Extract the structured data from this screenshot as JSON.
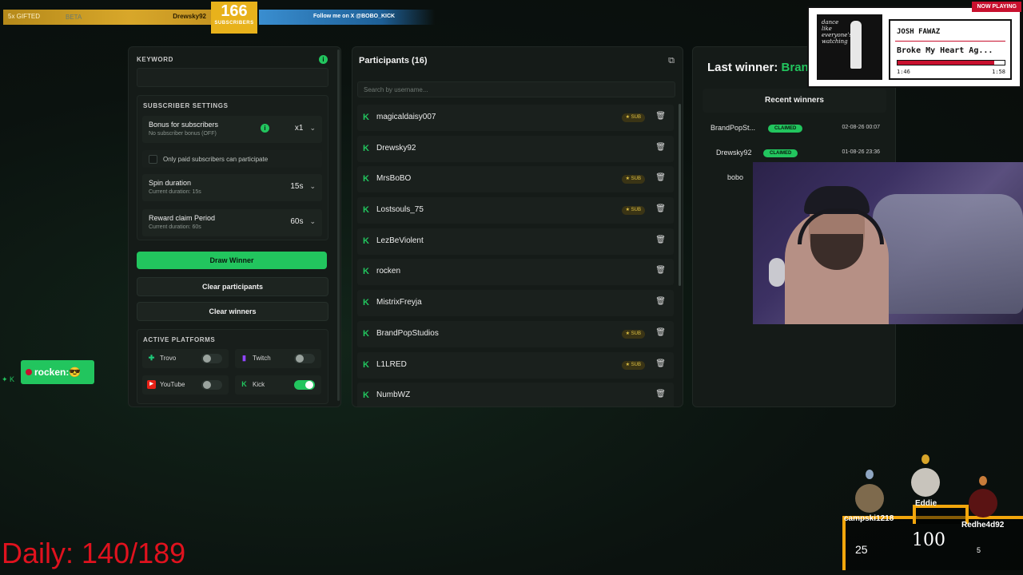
{
  "overlay": {
    "gift_text": "5x GIFTED",
    "gift_user": "Drewsky92",
    "beta_label": "BETA",
    "subscribers_count": "166",
    "subscribers_label": "SUBSCRIBERS",
    "follow_text": "Follow me on X @BOBO_KICK"
  },
  "settings": {
    "keyword_label": "KEYWORD",
    "keyword_value": "",
    "subscriber_settings_label": "SUBSCRIBER SETTINGS",
    "bonus_title": "Bonus for subscribers",
    "bonus_sub": "No subscriber bonus (OFF)",
    "bonus_value": "x1",
    "paid_only_label": "Only paid subscribers can participate",
    "spin_title": "Spin duration",
    "spin_sub": "Current duration: 15s",
    "spin_value": "15s",
    "reward_title": "Reward claim Period",
    "reward_sub": "Current duration: 60s",
    "reward_value": "60s",
    "draw_label": "Draw Winner",
    "clear_participants_label": "Clear participants",
    "clear_winners_label": "Clear winners",
    "active_platforms_label": "ACTIVE PLATFORMS",
    "platforms": [
      {
        "name": "Trovo",
        "enabled": false,
        "color": "#1ec97a"
      },
      {
        "name": "Twitch",
        "enabled": false,
        "color": "#9146ff"
      },
      {
        "name": "YouTube",
        "enabled": false,
        "color": "#e62117"
      },
      {
        "name": "Kick",
        "enabled": true,
        "color": "#22c55e"
      }
    ]
  },
  "participants": {
    "title": "Participants (16)",
    "search_placeholder": "Search by username...",
    "sub_badge": "SUB",
    "items": [
      {
        "name": "magicaldaisy007",
        "sub": true
      },
      {
        "name": "Drewsky92",
        "sub": false
      },
      {
        "name": "MrsBoBO",
        "sub": true
      },
      {
        "name": "Lostsouls_75",
        "sub": true
      },
      {
        "name": "LezBeViolent",
        "sub": false
      },
      {
        "name": "rocken",
        "sub": false
      },
      {
        "name": "MistrixFreyja",
        "sub": false
      },
      {
        "name": "BrandPopStudios",
        "sub": true
      },
      {
        "name": "L1LRED",
        "sub": true
      },
      {
        "name": "NumbWZ",
        "sub": false
      }
    ]
  },
  "winners": {
    "last_winner_label": "Last winner:",
    "last_winner_name": "Brand",
    "recent_label": "Recent winners",
    "items": [
      {
        "name": "BrandPopSt...",
        "status": "CLAIMED",
        "date": "02-08-26 00:07"
      },
      {
        "name": "Drewsky92",
        "status": "CLAIMED",
        "date": "01-08-26 23:36"
      },
      {
        "name": "bobo",
        "status": "",
        "date": ""
      }
    ]
  },
  "now_playing": {
    "badge": "NOW PLAYING",
    "album_text": "dance like everyone's watching",
    "artist": "JOSH FAWAZ",
    "song": "Broke My Heart Ag...",
    "elapsed": "1:46",
    "total": "1:58",
    "progress": 0.9
  },
  "chat_popup": {
    "text": "rocken:"
  },
  "daily": "Daily: 140/189",
  "leaderboard": {
    "first": {
      "name": "Eddie",
      "value": "100"
    },
    "second": {
      "name": "campski1218",
      "value": "25"
    },
    "third": {
      "name": "Redhe4d92",
      "value": "5"
    }
  }
}
